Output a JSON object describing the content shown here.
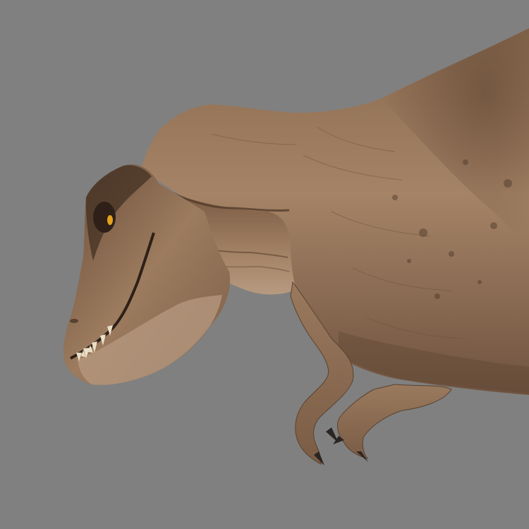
{
  "scene": {
    "subject": "dinosaur-render",
    "colors": {
      "background": "#808080",
      "skin_light": "#a58366",
      "skin_mid": "#8a6a4f",
      "skin_dark": "#5a412f",
      "skin_shadow": "#3f2d21",
      "belly": "#b69a80",
      "eye": "#e6a21c",
      "teeth": "#eadfc7",
      "claws": "#2a2522"
    }
  }
}
